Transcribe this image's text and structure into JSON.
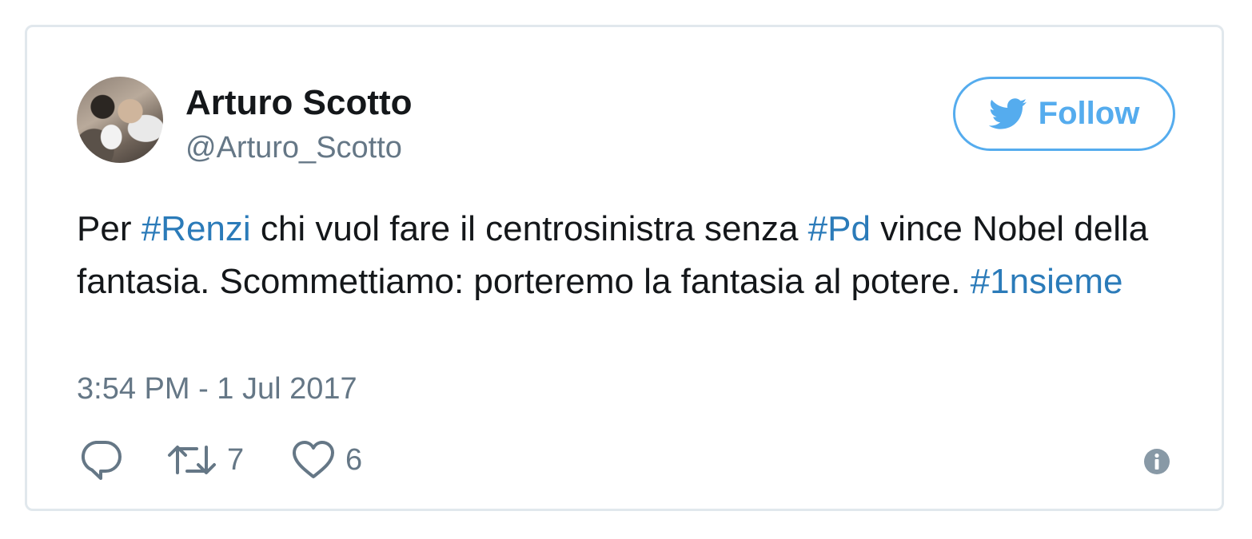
{
  "author": {
    "name": "Arturo Scotto",
    "handle": "@Arturo_Scotto"
  },
  "follow_button": {
    "label": "Follow"
  },
  "tweet": {
    "segments": {
      "t1": "Per ",
      "h1": "#Renzi",
      "t2": " chi vuol fare il centrosinistra senza ",
      "h2": "#Pd",
      "t3": " vince Nobel della fantasia. Scommettiamo: porteremo la fantasia al potere. ",
      "h3": "#1nsieme"
    },
    "timestamp": "3:54 PM - 1 Jul 2017"
  },
  "actions": {
    "retweet_count": "7",
    "like_count": "6"
  },
  "colors": {
    "accent": "#55acee",
    "hashtag": "#2b7bb9",
    "secondary_text": "#657786",
    "primary_text": "#14171a",
    "border": "#e1e8ed"
  },
  "icons": {
    "follow": "twitter-bird-icon",
    "reply": "reply-icon",
    "retweet": "retweet-icon",
    "like": "heart-icon",
    "info": "info-icon"
  }
}
